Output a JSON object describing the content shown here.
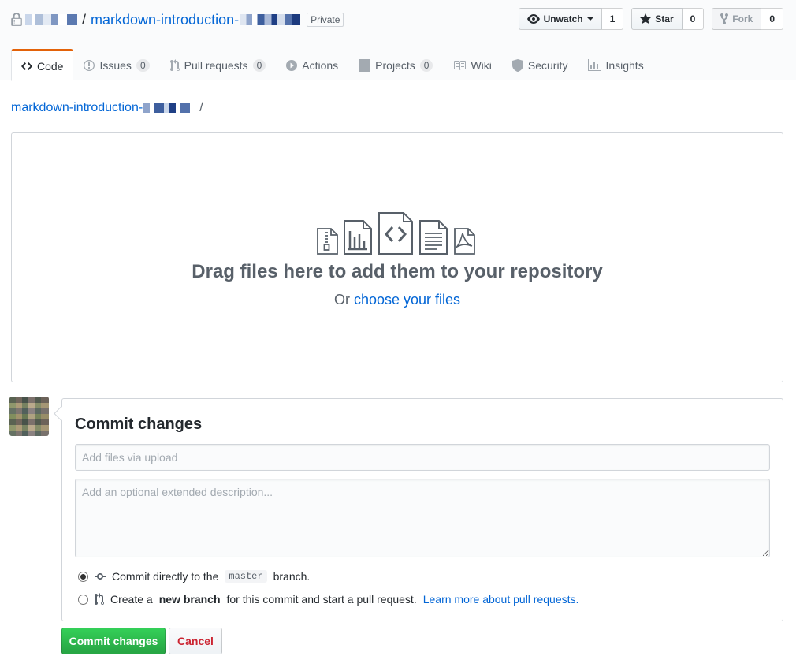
{
  "repo": {
    "name": "markdown-introduction-",
    "visibility": "Private",
    "separator": "/"
  },
  "actions": {
    "watch": {
      "label": "Unwatch",
      "count": "1",
      "icon": "eye-icon"
    },
    "star": {
      "label": "Star",
      "count": "0",
      "icon": "star-icon"
    },
    "fork": {
      "label": "Fork",
      "count": "0",
      "icon": "repo-forked-icon"
    }
  },
  "nav": {
    "tabs": [
      {
        "label": "Code",
        "icon": "code-icon",
        "counter": null,
        "selected": true
      },
      {
        "label": "Issues",
        "icon": "issue-opened-icon",
        "counter": "0"
      },
      {
        "label": "Pull requests",
        "icon": "git-pull-request-icon",
        "counter": "0"
      },
      {
        "label": "Actions",
        "icon": "play-icon",
        "counter": null
      },
      {
        "label": "Projects",
        "icon": "project-icon",
        "counter": "0"
      },
      {
        "label": "Wiki",
        "icon": "book-icon",
        "counter": null
      },
      {
        "label": "Security",
        "icon": "shield-icon",
        "counter": null
      },
      {
        "label": "Insights",
        "icon": "graph-icon",
        "counter": null
      }
    ]
  },
  "breadcrumb": {
    "repo": "markdown-introduction-",
    "separator": "/"
  },
  "dropzone": {
    "title": "Drag files here to add them to your repository",
    "or": "Or",
    "choose_link": "choose your files",
    "icons": [
      "file-zip-icon",
      "file-chart-icon",
      "file-code-icon",
      "file-text-icon",
      "file-pdf-icon"
    ]
  },
  "commit": {
    "heading": "Commit changes",
    "summary_placeholder": "Add files via upload",
    "description_placeholder": "Add an optional extended description...",
    "option_direct": {
      "prefix": "Commit directly to the",
      "branch": "master",
      "suffix": "branch."
    },
    "option_new": {
      "prefix": "Create a",
      "bold": "new branch",
      "suffix": "for this commit and start a pull request.",
      "link": "Learn more about pull requests."
    },
    "submit_label": "Commit changes",
    "cancel_label": "Cancel"
  },
  "colors": {
    "link": "#0366d6",
    "primary_green": "#28a745",
    "cancel_red": "#cb2431",
    "tab_accent": "#e36209"
  }
}
